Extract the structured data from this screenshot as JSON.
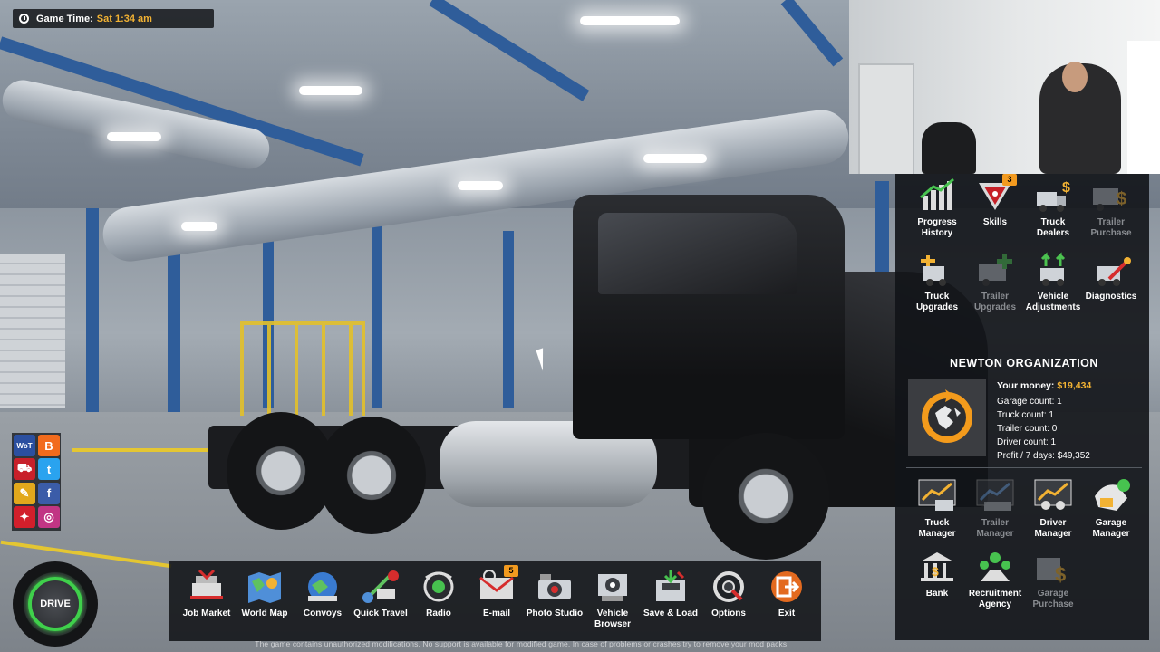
{
  "hud": {
    "game_time_label": "Game Time:",
    "game_time_value": "Sat 1:34 am",
    "drive_label": "DRIVE"
  },
  "right_panel": {
    "top_icons": [
      {
        "label": "Progress\nHistory",
        "icon": "progress-history-icon",
        "enabled": true,
        "badge": ""
      },
      {
        "label": "Skills",
        "icon": "skills-icon",
        "enabled": true,
        "badge": "3"
      },
      {
        "label": "Truck Dealers",
        "icon": "truck-dealers-icon",
        "enabled": true,
        "badge": ""
      },
      {
        "label": "Trailer\nPurchase",
        "icon": "trailer-purchase-icon",
        "enabled": false,
        "badge": ""
      },
      {
        "label": "Truck\nUpgrades",
        "icon": "truck-upgrades-icon",
        "enabled": true,
        "badge": ""
      },
      {
        "label": "Trailer\nUpgrades",
        "icon": "trailer-upgrades-icon",
        "enabled": false,
        "badge": ""
      },
      {
        "label": "Vehicle\nAdjustments",
        "icon": "vehicle-adjustments-icon",
        "enabled": true,
        "badge": ""
      },
      {
        "label": "Diagnostics",
        "icon": "diagnostics-icon",
        "enabled": true,
        "badge": ""
      }
    ],
    "organization": {
      "name": "NEWTON ORGANIZATION",
      "money_label": "Your money:",
      "money_value": "$19,434",
      "garage_count": "Garage count: 1",
      "truck_count": "Truck count: 1",
      "trailer_count": "Trailer count: 0",
      "driver_count": "Driver count: 1",
      "profit": "Profit / 7 days: $49,352"
    },
    "manager_icons": [
      {
        "label": "Truck\nManager",
        "icon": "truck-manager-icon",
        "enabled": true
      },
      {
        "label": "Trailer\nManager",
        "icon": "trailer-manager-icon",
        "enabled": false
      },
      {
        "label": "Driver\nManager",
        "icon": "driver-manager-icon",
        "enabled": true
      },
      {
        "label": "Garage\nManager",
        "icon": "garage-manager-icon",
        "enabled": true
      },
      {
        "label": "Bank",
        "icon": "bank-icon",
        "enabled": true
      },
      {
        "label": "Recruitment\nAgency",
        "icon": "recruitment-agency-icon",
        "enabled": true
      },
      {
        "label": "Garage\nPurchase",
        "icon": "garage-purchase-icon",
        "enabled": false
      }
    ]
  },
  "bottom_menu": [
    {
      "label": "Job Market",
      "icon": "job-market-icon",
      "badge": ""
    },
    {
      "label": "World Map",
      "icon": "world-map-icon",
      "badge": ""
    },
    {
      "label": "Convoys",
      "icon": "convoys-icon",
      "badge": ""
    },
    {
      "label": "Quick Travel",
      "icon": "quick-travel-icon",
      "badge": ""
    },
    {
      "label": "Radio",
      "icon": "radio-icon",
      "badge": ""
    },
    {
      "label": "E-mail",
      "icon": "email-icon",
      "badge": "5"
    },
    {
      "label": "Photo Studio",
      "icon": "photo-studio-icon",
      "badge": ""
    },
    {
      "label": "Vehicle\nBrowser",
      "icon": "vehicle-browser-icon",
      "badge": ""
    },
    {
      "label": "Save & Load",
      "icon": "save-load-icon",
      "badge": ""
    },
    {
      "label": "Options",
      "icon": "options-icon",
      "badge": ""
    },
    {
      "label": "Exit",
      "icon": "exit-icon",
      "badge": ""
    }
  ],
  "social_icons": [
    {
      "icon": "world-of-trucks-icon",
      "glyph": "WoT",
      "color": "#2b4fa0"
    },
    {
      "icon": "blogger-icon",
      "glyph": "B",
      "color": "#f26b1d"
    },
    {
      "icon": "scs-truck-icon",
      "glyph": "⛟",
      "color": "#c8202a"
    },
    {
      "icon": "twitter-icon",
      "glyph": "t",
      "color": "#2aa3ef"
    },
    {
      "icon": "forum-icon",
      "glyph": "✎",
      "color": "#e2a81c"
    },
    {
      "icon": "facebook-icon",
      "glyph": "f",
      "color": "#3b5ca8"
    },
    {
      "icon": "scs-blog-icon",
      "glyph": "✦",
      "color": "#d21f2b"
    },
    {
      "icon": "instagram-icon",
      "glyph": "◎",
      "color": "#c13584"
    }
  ],
  "footer_note": "The game contains unauthorized modifications. No support is available for modified game. In case of problems or crashes try to remove your mod packs!",
  "colors": {
    "accent_orange": "#f2b233",
    "drive_green": "#3fd04b",
    "badge_orange": "#f29a1f"
  }
}
